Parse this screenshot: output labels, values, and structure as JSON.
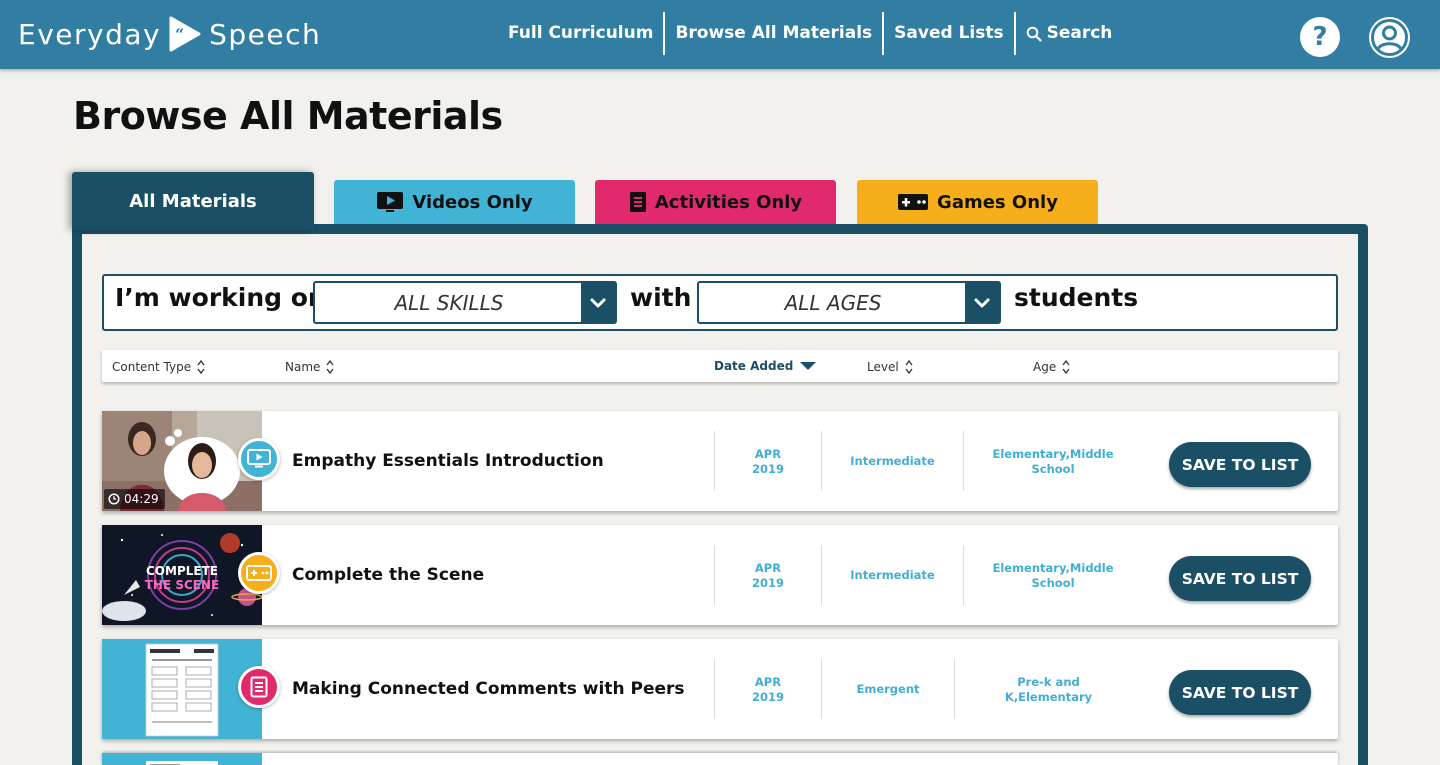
{
  "brand": {
    "word1": "Everyday",
    "word2": "Speech"
  },
  "nav": {
    "items": [
      "Full Curriculum",
      "Browse All Materials",
      "Saved Lists",
      "Search"
    ]
  },
  "header_icons": [
    "help-icon",
    "user-account-icon"
  ],
  "page_title": "Browse All Materials",
  "tabs": [
    {
      "label": "All Materials",
      "icon": "",
      "active": true,
      "color": "#1b4f66"
    },
    {
      "label": "Videos Only",
      "icon": "video-icon",
      "color": "#41b3d5"
    },
    {
      "label": "Activities Only",
      "icon": "document-icon",
      "color": "#e02a6d"
    },
    {
      "label": "Games Only",
      "icon": "gamepad-icon",
      "color": "#f6ae1a"
    }
  ],
  "filter": {
    "prefix": "I’m working on",
    "skills_value": "ALL SKILLS",
    "middle": "with",
    "ages_value": "ALL AGES",
    "suffix": "students"
  },
  "sort_columns": [
    {
      "label": "Content Type",
      "active": false
    },
    {
      "label": "Name",
      "active": false
    },
    {
      "label": "Date Added",
      "active": true,
      "direction": "desc"
    },
    {
      "label": "Level",
      "active": false
    },
    {
      "label": "Age",
      "active": false
    }
  ],
  "rows": [
    {
      "title": "Empathy Essentials Introduction",
      "type": "video",
      "duration": "04:29",
      "date_line1": "APR",
      "date_line2": "2019",
      "level": "Intermediate",
      "age_line1": "Elementary,Middle",
      "age_line2": "School",
      "save_label": "SAVE TO LIST"
    },
    {
      "title": "Complete the Scene",
      "type": "game",
      "thumb_text_line1": "COMPLETE",
      "thumb_text_line2": "THE SCENE",
      "date_line1": "APR",
      "date_line2": "2019",
      "level": "Intermediate",
      "age_line1": "Elementary,Middle",
      "age_line2": "School",
      "save_label": "SAVE TO LIST"
    },
    {
      "title": "Making Connected Comments with Peers",
      "type": "activity",
      "date_line1": "APR",
      "date_line2": "2019",
      "level": "Emergent",
      "age_line1": "Pre-k and",
      "age_line2": "K,Elementary",
      "save_label": "SAVE TO LIST"
    }
  ],
  "colors": {
    "header": "#327ea3",
    "navy": "#1b4f66",
    "accent_text": "#41aed3",
    "video": "#41b3d5",
    "activity": "#e02a6d",
    "game": "#f6ae1a"
  }
}
